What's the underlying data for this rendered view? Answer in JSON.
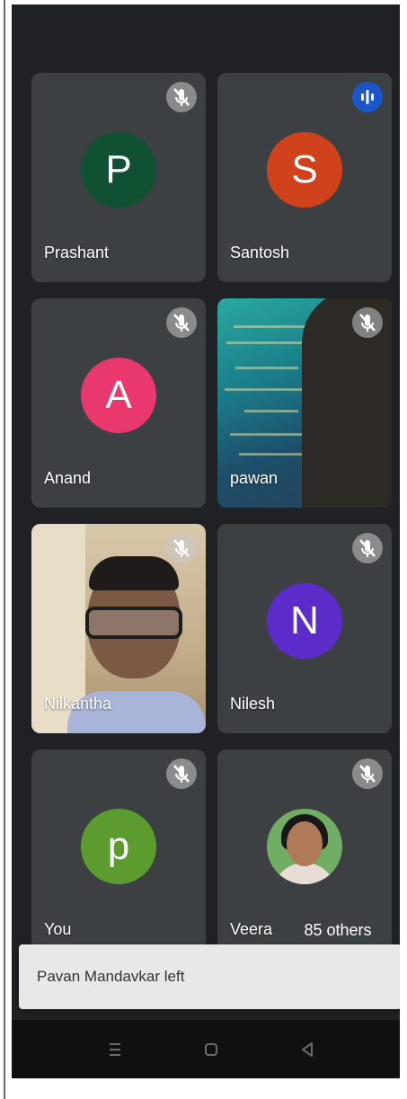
{
  "participants": [
    {
      "name": "Prashant",
      "initial": "P",
      "avatar_color": "#0f5132",
      "mic": "muted"
    },
    {
      "name": "Santosh",
      "initial": "S",
      "avatar_color": "#d0421b",
      "mic": "speaking"
    },
    {
      "name": "Anand",
      "initial": "A",
      "avatar_color": "#e8386d",
      "mic": "muted"
    },
    {
      "name": "pawan",
      "initial": "",
      "avatar_color": "",
      "mic": "muted",
      "video": true
    },
    {
      "name": "Nilkantha",
      "initial": "",
      "avatar_color": "",
      "mic": "muted",
      "video": true
    },
    {
      "name": "Nilesh",
      "initial": "N",
      "avatar_color": "#5b2cc9",
      "mic": "muted"
    },
    {
      "name": "You",
      "initial": "p",
      "avatar_color": "#5c9b2e",
      "mic": "muted"
    },
    {
      "name": "Veera",
      "initial": "",
      "avatar_color": "",
      "mic": "muted",
      "photo": true
    }
  ],
  "others_count": "85 others",
  "notification": "Pavan Mandavkar left",
  "icons": {
    "muted": "mic-off-icon",
    "speaking": "audio-level-icon",
    "nav_recents": "recents-icon",
    "nav_home": "home-icon",
    "nav_back": "back-icon"
  }
}
